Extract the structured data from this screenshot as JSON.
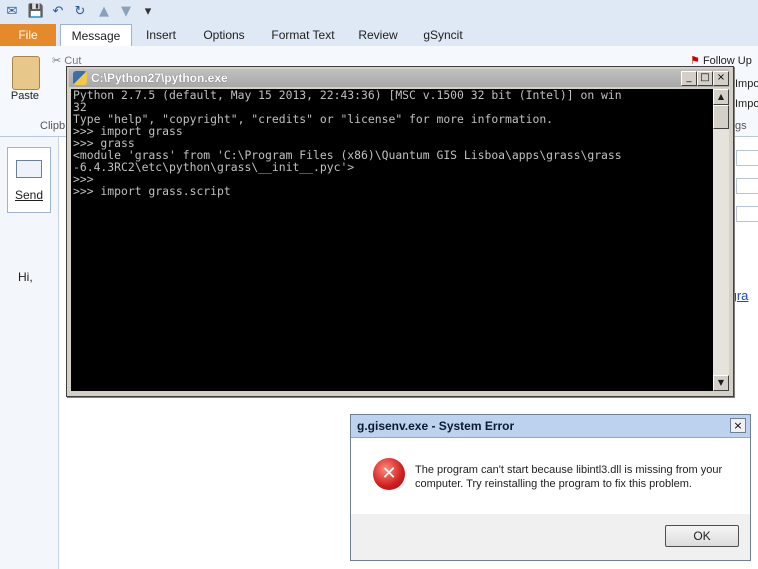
{
  "outlook": {
    "tabs": [
      {
        "label": "File"
      },
      {
        "label": "Message"
      },
      {
        "label": "Insert"
      },
      {
        "label": "Options"
      },
      {
        "label": "Format Text"
      },
      {
        "label": "Review"
      },
      {
        "label": "gSyncit"
      }
    ],
    "paste_label": "Paste",
    "cut_label": "Cut",
    "clipboard_group": "Clipb",
    "follow_up": "Follow Up",
    "importance_1": "Impo",
    "importance_2": "Impo",
    "group_suffix": "gs",
    "send_label": "Send",
    "body_greeting": "Hi,",
    "link_fragment": "/gra"
  },
  "console": {
    "title": "C:\\Python27\\python.exe",
    "lines": [
      "Python 2.7.5 (default, May 15 2013, 22:43:36) [MSC v.1500 32 bit (Intel)] on win",
      "32",
      "Type \"help\", \"copyright\", \"credits\" or \"license\" for more information.",
      ">>> import grass",
      ">>> grass",
      "<module 'grass' from 'C:\\Program Files (x86)\\Quantum GIS Lisboa\\apps\\grass\\grass",
      "-6.4.3RC2\\etc\\python\\grass\\__init__.pyc'>",
      ">>>",
      ">>> import grass.script"
    ]
  },
  "error_dialog": {
    "title": "g.gisenv.exe - System Error",
    "message": "The program can't start because libintl3.dll is missing from your computer. Try reinstalling the program to fix this problem.",
    "ok_label": "OK"
  }
}
